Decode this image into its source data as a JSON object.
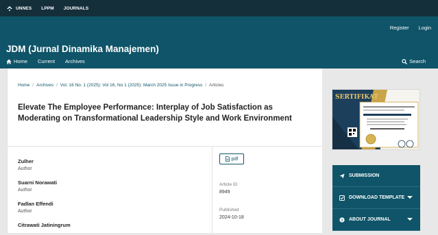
{
  "topbar": {
    "links": [
      "UNNES",
      "LPPM",
      "JOURNALS"
    ]
  },
  "header": {
    "register": "Register",
    "login": "Login",
    "site_title": "JDM (Jurnal Dinamika Manajemen)",
    "nav": [
      "Home",
      "Current",
      "Archives"
    ],
    "search": "Search"
  },
  "breadcrumb": {
    "items": [
      "Home",
      "Archives",
      "Vol. 16 No. 1 (2025): Vol 16, No 1 (2025): March 2025 Issue in Progress",
      "Articles"
    ]
  },
  "article": {
    "title": "Elevate The Employee Performance: Interplay of Job Satisfaction as Moderating on Transformational Leadership Style and Work Environment",
    "authors": [
      {
        "name": "Zulher",
        "role": "Author"
      },
      {
        "name": "Suarni Norawati",
        "role": "Author"
      },
      {
        "name": "Fadlan Effendi",
        "role": "Author"
      },
      {
        "name": "Citrawati Jatiningrum",
        "role": ""
      }
    ],
    "pdf_label": "pdf",
    "article_id_label": "Article ID",
    "article_id": "8949",
    "published_label": "Published",
    "published": "2024-10-18"
  },
  "sidebar": {
    "certificate_heading": "SERTIFIKAT",
    "blocks": [
      {
        "label": "SUBMISSION",
        "icon": "paper-plane-icon",
        "dropdown": false
      },
      {
        "label": "DOWNLOAD TEMPLATE",
        "icon": "download-icon",
        "dropdown": true
      },
      {
        "label": "ABOUT JOURNAL",
        "icon": "info-icon",
        "dropdown": true
      }
    ]
  },
  "colors": {
    "topbar": "#142f3a",
    "header": "#0f5468",
    "page_bg": "#e8e8e8",
    "accent": "#0f5468"
  }
}
